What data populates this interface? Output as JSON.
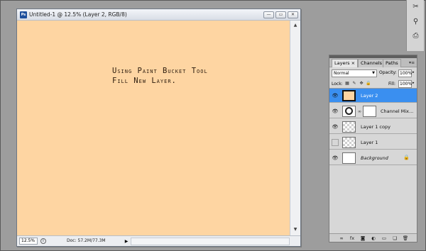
{
  "document": {
    "title": "Untitled-1 @ 12.5% (Layer 2, RGB/8)",
    "app_icon": "Ps",
    "canvas_color": "#fed5a2",
    "canvas_text": {
      "line1": "Using Paint Bucket Tool",
      "line2": "Fill New Layer."
    },
    "window_buttons": {
      "minimize": "—",
      "restore": "▭",
      "close": "✕"
    },
    "status": {
      "zoom": "12.5%",
      "doc_size": "Doc: 57.2M/77.3M",
      "arrow": "▶"
    }
  },
  "tools": [
    {
      "icon": "crop-tool-icon",
      "glyph": "✂"
    },
    {
      "icon": "history-brush-icon",
      "glyph": "⚲"
    },
    {
      "icon": "clone-stamp-icon",
      "glyph": "⎙"
    }
  ],
  "layers_panel": {
    "tabs": [
      {
        "label": "Layers ×",
        "active": true
      },
      {
        "label": "Channels",
        "active": false
      },
      {
        "label": "Paths",
        "active": false
      }
    ],
    "menu_glyph": "▾≡",
    "blend_mode": "Normal",
    "opacity_label": "Opacity:",
    "opacity": "100%",
    "lock_label": "Lock:",
    "fill_label": "Fill:",
    "fill": "100%",
    "layers": [
      {
        "name": "Layer 2",
        "visible": true,
        "selected": true,
        "type": "fill"
      },
      {
        "name": "Channel Mix...",
        "visible": true,
        "selected": false,
        "type": "adjustment"
      },
      {
        "name": "Layer 1 copy",
        "visible": true,
        "selected": false,
        "type": "pixel"
      },
      {
        "name": "Layer 1",
        "visible": false,
        "selected": false,
        "type": "pixel"
      },
      {
        "name": "Background",
        "visible": true,
        "selected": false,
        "type": "background",
        "locked": true
      }
    ],
    "footer_icons": [
      "link-icon",
      "fx-icon",
      "mask-icon",
      "adjustment-icon",
      "group-icon",
      "new-layer-icon",
      "trash-icon"
    ]
  }
}
